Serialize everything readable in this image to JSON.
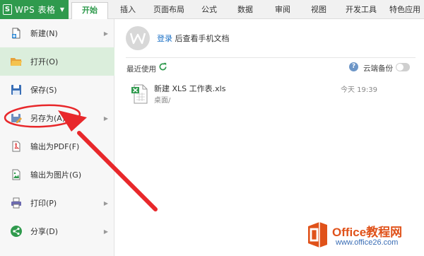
{
  "app": {
    "title": "WPS 表格",
    "accent": "#2f9a4d"
  },
  "ribbon_tabs": [
    {
      "label": "开始",
      "active": true
    },
    {
      "label": "插入"
    },
    {
      "label": "页面布局"
    },
    {
      "label": "公式"
    },
    {
      "label": "数据"
    },
    {
      "label": "审阅"
    },
    {
      "label": "视图"
    },
    {
      "label": "开发工具"
    },
    {
      "label": "特色应用"
    }
  ],
  "menu": {
    "items": [
      {
        "label": "新建(N)",
        "icon": "new-doc-icon",
        "has_submenu": true
      },
      {
        "label": "打开(O)",
        "icon": "open-folder-icon",
        "active": true
      },
      {
        "label": "保存(S)",
        "icon": "save-icon"
      },
      {
        "label": "另存为(A)",
        "icon": "save-as-icon",
        "has_submenu": true
      },
      {
        "label": "输出为PDF(F)",
        "icon": "pdf-icon"
      },
      {
        "label": "输出为图片(G)",
        "icon": "image-export-icon"
      },
      {
        "label": "打印(P)",
        "icon": "print-icon",
        "has_submenu": true
      },
      {
        "label": "分享(D)",
        "icon": "share-icon",
        "has_submenu": true
      }
    ]
  },
  "login": {
    "link": "登录",
    "rest": "后查看手机文档"
  },
  "recent": {
    "title": "最近使用",
    "cloud_backup_label": "云端备份",
    "cloud_backup_on": false,
    "files": [
      {
        "name": "新建 XLS 工作表.xls",
        "path": "桌面/",
        "time": "今天 19:39"
      }
    ]
  },
  "annotation": {
    "color": "#e8282b",
    "target": "另存为(A)"
  },
  "watermark": {
    "brand": "Office教程网",
    "url": "www.office26.com"
  }
}
